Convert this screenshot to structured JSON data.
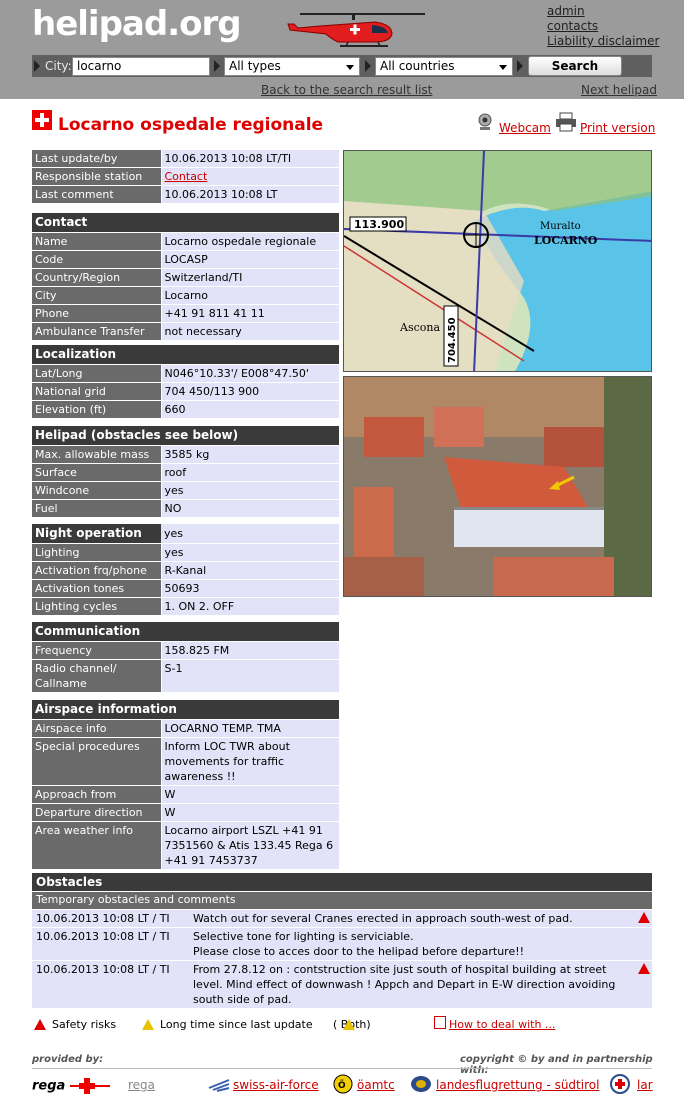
{
  "header": {
    "logo": "helipad.org",
    "links": [
      "admin",
      "contacts",
      "Liability disclaimer"
    ],
    "search": {
      "city_label": "City:",
      "city_value": "locarno",
      "type_value": "All types",
      "country_value": "All countries",
      "button": "Search"
    },
    "back_link": "Back to the search result list",
    "next_link": "Next helipad"
  },
  "title": "Locarno ospedale regionale",
  "actions": {
    "webcam": "Webcam",
    "print": "Print version"
  },
  "general": [
    {
      "k": "Last update/by",
      "v": "10.06.2013 10:08 LT/TI"
    },
    {
      "k": "Responsible station",
      "v": "Contact"
    },
    {
      "k": "Last comment",
      "v": "10.06.2013 10:08 LT"
    }
  ],
  "contact": {
    "title": "Contact",
    "rows": [
      {
        "k": "Name",
        "v": "Locarno ospedale regionale"
      },
      {
        "k": "Code",
        "v": "LOCASP"
      },
      {
        "k": "Country/Region",
        "v": "Switzerland/TI"
      },
      {
        "k": "City",
        "v": "Locarno"
      },
      {
        "k": "Phone",
        "v": "+41 91 811 41 11"
      },
      {
        "k": "Ambulance Transfer",
        "v": "not necessary"
      }
    ]
  },
  "localization": {
    "title": "Localization",
    "rows": [
      {
        "k": "Lat/Long",
        "v": "N046°10.33'/ E008°47.50'"
      },
      {
        "k": "National grid",
        "v": "704 450/113 900"
      },
      {
        "k": "Elevation (ft)",
        "v": "660"
      }
    ]
  },
  "helipad": {
    "title": "Helipad (obstacles see below)",
    "rows": [
      {
        "k": "Max. allowable mass",
        "v": "3585 kg"
      },
      {
        "k": "Surface",
        "v": "roof"
      },
      {
        "k": "Windcone",
        "v": "yes"
      },
      {
        "k": "Fuel",
        "v": "NO"
      }
    ]
  },
  "night": {
    "title": "Night operation",
    "title_value": "yes",
    "rows": [
      {
        "k": "Lighting",
        "v": "yes"
      },
      {
        "k": "Activation frq/phone",
        "v": "R-Kanal"
      },
      {
        "k": "Activation tones",
        "v": "50693"
      },
      {
        "k": "Lighting cycles",
        "v": "1. ON 2. OFF"
      }
    ]
  },
  "communication": {
    "title": "Communication",
    "rows": [
      {
        "k": "Frequency",
        "v": "158.825 FM"
      },
      {
        "k": "Radio channel/ Callname",
        "v": "S-1"
      }
    ]
  },
  "airspace": {
    "title": "Airspace information",
    "rows": [
      {
        "k": "Airspace info",
        "v": "LOCARNO TEMP. TMA"
      },
      {
        "k": "Special procedures",
        "v": "Inform LOC TWR about movements for traffic awareness !!"
      },
      {
        "k": "Approach from",
        "v": "W"
      },
      {
        "k": "Departure direction",
        "v": "W"
      },
      {
        "k": "Area weather info",
        "v": "Locarno airport LSZL +41 91 7351560 & Atis 133.45 Rega 6 +41 91 7453737"
      }
    ]
  },
  "map_labels": {
    "grid_x": "113.900",
    "grid_y": "704.450",
    "town": "LOCARNO",
    "town2": "Muralto",
    "town3": "Ascona"
  },
  "obstacles": {
    "title": "Obstacles",
    "subtitle": "Temporary obstacles and comments",
    "rows": [
      {
        "date": "10.06.2013 10:08 LT / TI",
        "text": "Watch out for several Cranes erected in approach south-west of pad.",
        "risk": true
      },
      {
        "date": "10.06.2013 10:08 LT / TI",
        "text": "Selective tone for lighting is serviciable.\nPlease close to acces door to the helipad before departure!!",
        "risk": false
      },
      {
        "date": "10.06.2013 10:08 LT / TI",
        "text": "From 27.8.12 on : contstruction site just south of hospital building at street level. Mind effect of downwash ! Appch and Depart in E-W direction avoiding south side of pad.",
        "risk": true
      }
    ]
  },
  "legend": {
    "safety": "Safety risks",
    "longtime": "Long time since last update",
    "both": "(  Both)",
    "deal": "How to deal with ..."
  },
  "footer": {
    "provided": "provided by:",
    "copyright": "copyright © by and in partnership with:",
    "rega_logo": "rega",
    "rega_link": "rega",
    "partners": [
      "swiss-air-force",
      "öamtc",
      "landesflugrettung - südtirol",
      "lar"
    ]
  },
  "colors": {
    "header_bg": "#9b9b9b",
    "section_bg": "#3a3a3a",
    "key_bg": "#6a6a6a",
    "value_bg": "#e2e2f8",
    "accent": "#dd0000"
  }
}
